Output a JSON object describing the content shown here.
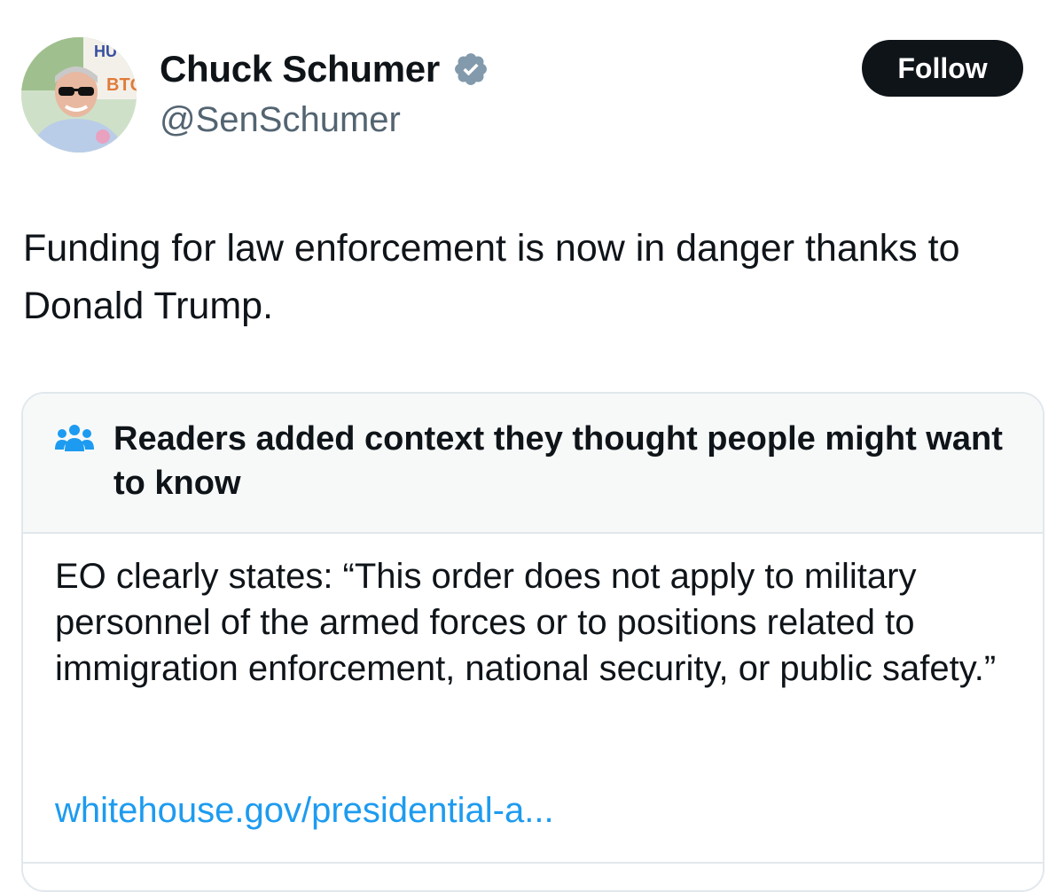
{
  "author": {
    "display_name": "Chuck Schumer",
    "handle": "@SenSchumer",
    "verified_icon": "verified-badge-icon",
    "avatar_sign_text_top": "HU",
    "avatar_sign_text_side": "BTQ"
  },
  "follow_button": {
    "label": "Follow"
  },
  "tweet": {
    "text": "Funding for law enforcement is now in danger thanks to Donald Trump."
  },
  "community_note": {
    "icon": "readers-group-icon",
    "title": "Readers added context they thought people might want to know",
    "body": "EO clearly states: “This order does not apply to military personnel of the armed forces or to positions related to immigration enforcement, national security, or public safety.”",
    "link_text": "whitehouse.gov/presidential-a..."
  },
  "colors": {
    "text_primary": "#0f1419",
    "text_secondary": "#536471",
    "link": "#1d9bf0",
    "verified_badge": "#829aab",
    "note_header_bg": "#f7f9f9",
    "border": "#e1e8ed"
  }
}
